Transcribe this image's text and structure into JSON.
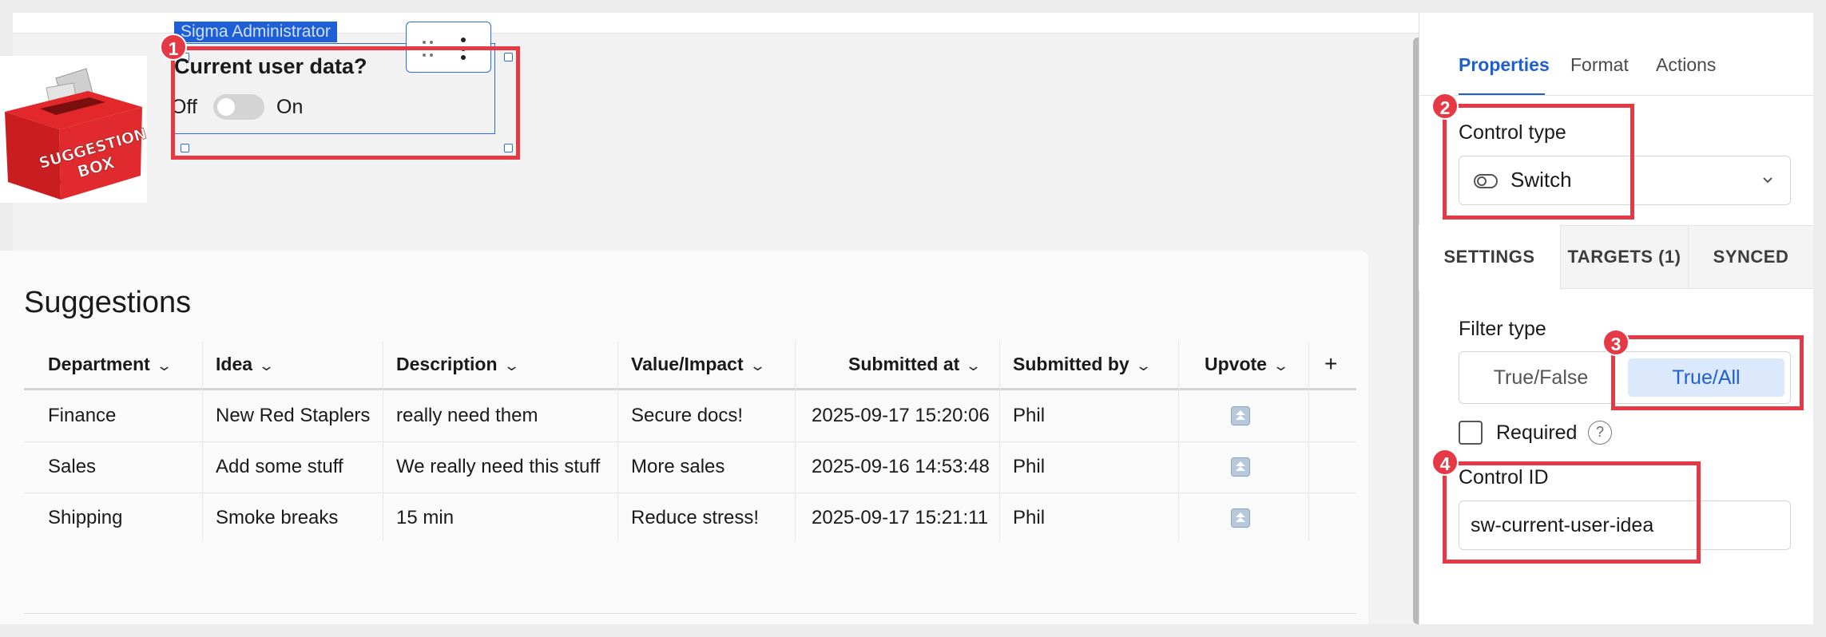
{
  "control": {
    "user_badge": "Sigma Administrator",
    "title": "Current user data?",
    "off_label": "Off",
    "on_label": "On",
    "switch_state": "off"
  },
  "table": {
    "title": "Suggestions",
    "columns": [
      "Department",
      "Idea",
      "Description",
      "Value/Impact",
      "Submitted at",
      "Submitted by",
      "Upvote"
    ],
    "add_column_label": "+",
    "rows": [
      [
        "Finance",
        "New Red Staplers",
        "really need them",
        "Secure docs!",
        "2025-09-17 15:20:06",
        "Phil"
      ],
      [
        "Sales",
        "Add some stuff",
        "We really need this stuff",
        "More sales",
        "2025-09-16 14:53:48",
        "Phil"
      ],
      [
        "Shipping",
        "Smoke breaks",
        "15 min",
        "Reduce stress!",
        "2025-09-17 15:21:11",
        "Phil"
      ]
    ]
  },
  "panel": {
    "tabs": [
      "Properties",
      "Format",
      "Actions"
    ],
    "active_tab": "Properties",
    "control_type_label": "Control type",
    "control_type_value": "Switch",
    "subtabs": [
      "SETTINGS",
      "TARGETS (1)",
      "SYNCED"
    ],
    "filter_type_label": "Filter type",
    "filter_options": [
      "True/False",
      "True/All"
    ],
    "filter_selected": "True/All",
    "required_label": "Required",
    "required_help": "?",
    "control_id_label": "Control ID",
    "control_id_value": "sw-current-user-idea"
  },
  "image": {
    "caption_line1": "SUGGESTION",
    "caption_line2": "BOX"
  },
  "callouts": [
    "1",
    "2",
    "3",
    "4"
  ],
  "colors": {
    "accent": "#1f5fd6",
    "callout": "#e63946",
    "selected_segment_bg": "#dce8fb"
  }
}
